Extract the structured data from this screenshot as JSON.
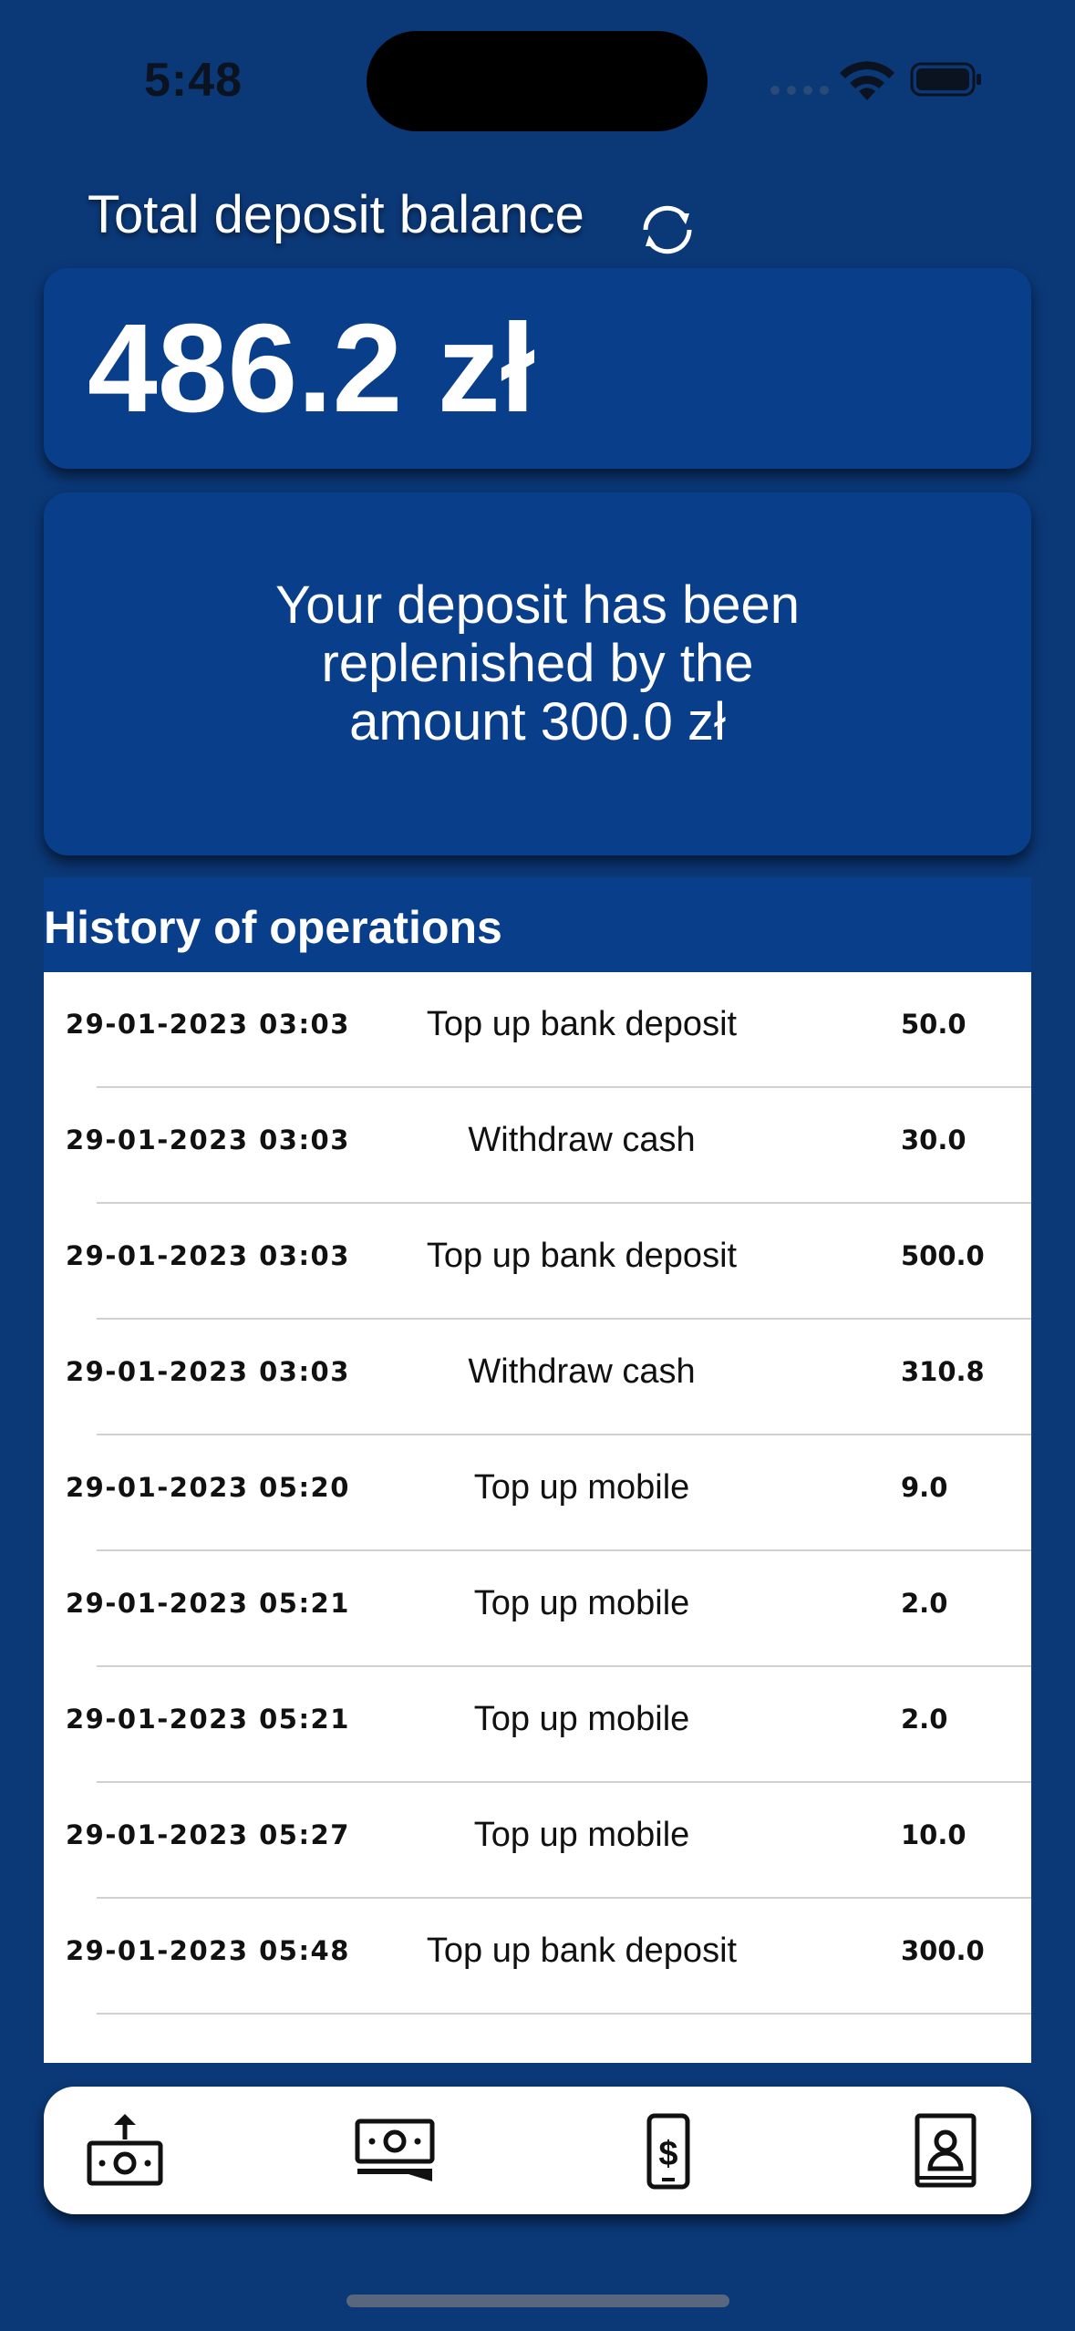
{
  "status_bar": {
    "time": "5:48"
  },
  "header": {
    "title": "Total deposit balance",
    "refresh_icon": "refresh-icon"
  },
  "balance": {
    "amount": "486.2 zł"
  },
  "notification": {
    "message": "Your deposit has been replenished by the amount 300.0 zł"
  },
  "history": {
    "title": "History of operations",
    "rows": [
      {
        "date": "29-01-2023 03:03",
        "operation": "Top up bank deposit",
        "amount": "50.0"
      },
      {
        "date": "29-01-2023 03:03",
        "operation": "Withdraw cash",
        "amount": "30.0"
      },
      {
        "date": "29-01-2023 03:03",
        "operation": "Top up bank deposit",
        "amount": "500.0"
      },
      {
        "date": "29-01-2023 03:03",
        "operation": "Withdraw cash",
        "amount": "310.8"
      },
      {
        "date": "29-01-2023 05:20",
        "operation": "Top up mobile",
        "amount": "9.0"
      },
      {
        "date": "29-01-2023 05:21",
        "operation": "Top up mobile",
        "amount": "2.0"
      },
      {
        "date": "29-01-2023 05:21",
        "operation": "Top up mobile",
        "amount": "2.0"
      },
      {
        "date": "29-01-2023 05:27",
        "operation": "Top up mobile",
        "amount": "10.0"
      },
      {
        "date": "29-01-2023 05:48",
        "operation": "Top up bank deposit",
        "amount": "300.0"
      }
    ]
  },
  "tabbar": {
    "tabs": [
      {
        "icon": "deposit-money-icon"
      },
      {
        "icon": "withdraw-cash-icon"
      },
      {
        "icon": "mobile-payment-icon"
      },
      {
        "icon": "contacts-book-icon"
      }
    ]
  },
  "colors": {
    "background": "#0b3877",
    "card": "#083e8a",
    "list": "#ffffff"
  }
}
